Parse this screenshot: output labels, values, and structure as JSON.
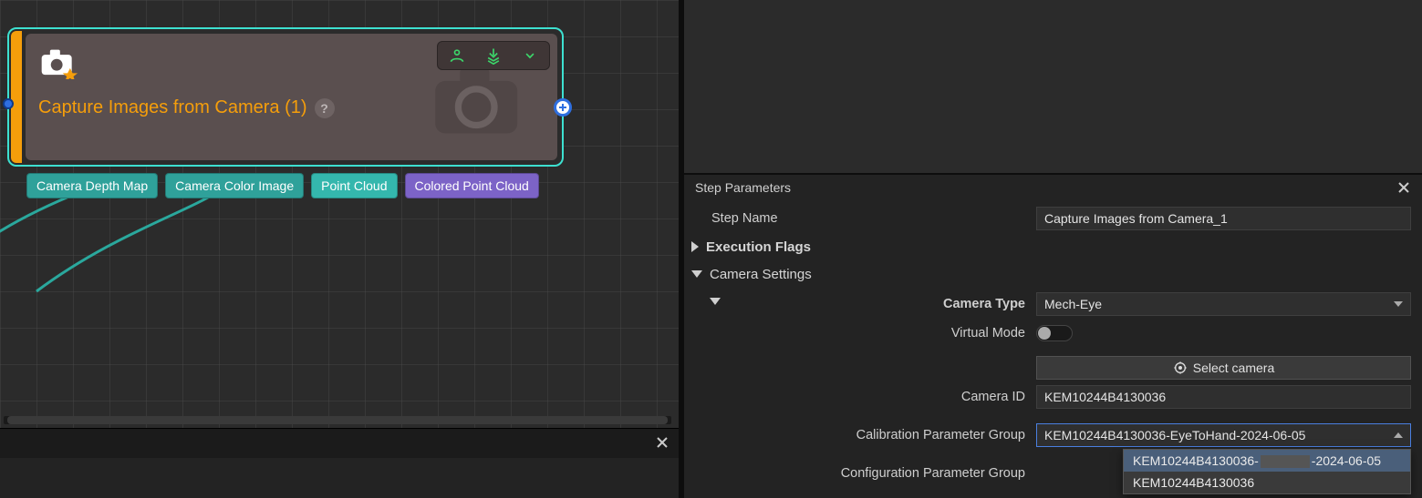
{
  "canvas": {
    "node": {
      "title": "Capture Images from Camera (1)",
      "help": "?"
    },
    "outputs": {
      "depth": "Camera Depth Map",
      "color": "Camera Color Image",
      "pc": "Point Cloud",
      "cpc": "Colored Point Cloud"
    }
  },
  "panel": {
    "title": "Step Parameters",
    "stepName": {
      "label": "Step Name",
      "value": "Capture Images from Camera_1"
    },
    "sections": {
      "execFlags": "Execution Flags",
      "camSettings": "Camera Settings"
    },
    "cameraType": {
      "label": "Camera Type",
      "value": "Mech-Eye"
    },
    "virtualMode": {
      "label": "Virtual Mode"
    },
    "selectCamera": {
      "label": "Select camera"
    },
    "cameraId": {
      "label": "Camera ID",
      "value": "KEM10244B4130036"
    },
    "calibGroup": {
      "label": "Calibration Parameter Group",
      "value": "KEM10244B4130036-EyeToHand-2024-06-05"
    },
    "calibOptions": {
      "opt0_pre": "KEM10244B4130036-",
      "opt0_post": "-2024-06-05",
      "opt1": "KEM10244B4130036"
    },
    "configGroup": {
      "label": "Configuration Parameter Group"
    }
  }
}
